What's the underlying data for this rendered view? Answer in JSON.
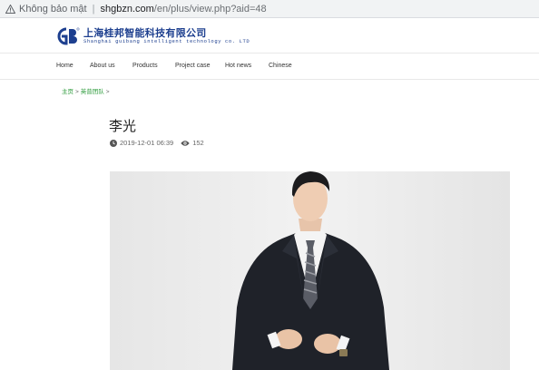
{
  "browser": {
    "security_label": "Không bảo mật",
    "url_host": "shgbzn.com",
    "url_path": "/en/plus/view.php?aid=48"
  },
  "logo": {
    "mark_text": "GB",
    "chinese_name": "上海桂邦智能科技有限公司",
    "english_name": "Shanghai guibang intelligent technology co. LTD",
    "brand_color": "#1d3f8f"
  },
  "nav": {
    "items": [
      "Home",
      "About us",
      "Products",
      "Project case",
      "Hot news",
      "Chinese"
    ]
  },
  "breadcrumb": {
    "home": "主页",
    "section": "英普团队",
    "separator": ">"
  },
  "article": {
    "title": "李光",
    "date": "2019-12-01 06:39",
    "views": "152",
    "date_icon": "clock-icon",
    "views_icon": "eye-icon"
  },
  "colors": {
    "breadcrumb": "#2b9a3a",
    "photo_background": "#efefef"
  }
}
